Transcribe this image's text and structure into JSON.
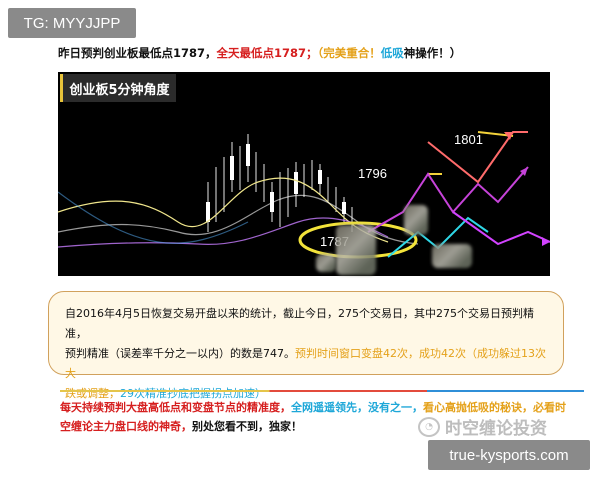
{
  "badges": {
    "tg": "TG: MYYJJPP",
    "site": "true-kysports.com"
  },
  "headline": {
    "part1": "昨日预判创业板最低点1787，",
    "part2": "全天最低点1787；",
    "part3": "（完美重合！",
    "part4": "低吸",
    "part5": "神操作！）"
  },
  "chart": {
    "title": "创业板5分钟角度",
    "labels": [
      "1801",
      "1796",
      "1787"
    ]
  },
  "note": {
    "line1": "自2016年4月5日恢复交易开盘以来的统计，截止今日，275个交易日，其中275个交易日预判精准，",
    "line2a": "预判精准（误差率千分之一以内）的数是747。",
    "line2b": "预判时间窗口变盘42次，",
    "line2c": "成功42次（成功躲过13次大",
    "line3a": "跌或调整，",
    "line3b": "29次精准抄底把握拐点加速）"
  },
  "footer": {
    "line1a": "每天持续预判大盘高低点和变盘节点的精准度，",
    "line1b": "全网遥遥领先，没有之一，",
    "line1c": "看心高抛低吸的秘诀，必看时",
    "line2a": "空缠论主力盘口线的神奇，",
    "line2b": "别处您看不到，独家！"
  },
  "watermark": {
    "text": "时空缠论投资"
  },
  "colors": {
    "red": "#d61f1f",
    "orange": "#e4a11a",
    "blue": "#1ea7d8",
    "chart_bg": "#000000"
  }
}
